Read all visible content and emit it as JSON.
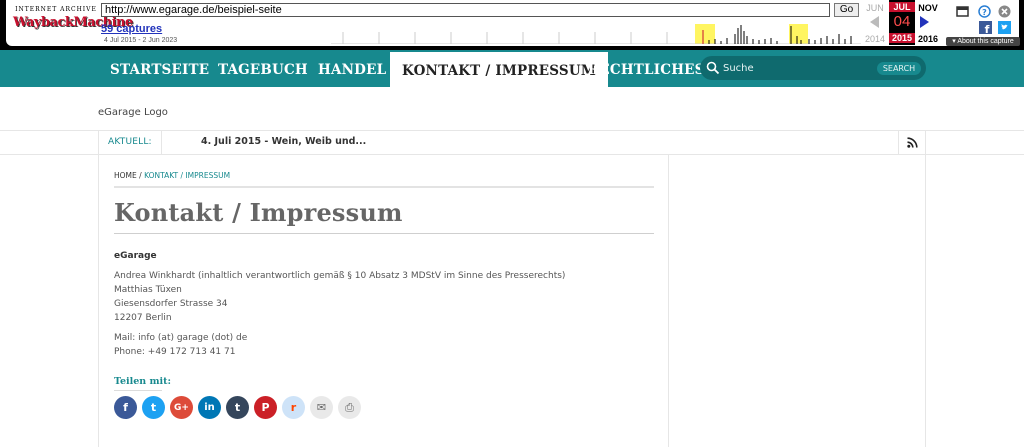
{
  "wayback": {
    "logo_top": "INTERNET ARCHIVE",
    "logo_main": "WaybackMachine",
    "url": "http://www.egarage.de/beispiel-seite",
    "go_label": "Go",
    "captures": "59 captures",
    "range": "4 Jul 2015 - 2 Jun 2023",
    "prev_month": "JUN",
    "cur_month": "JUL",
    "next_month": "NOV",
    "cur_day": "04",
    "prev_year": "2014",
    "cur_year": "2015",
    "next_year": "2016",
    "about": "▾ About this capture",
    "colors": {
      "accent": "#c8102e",
      "link": "#2233bb"
    }
  },
  "nav": {
    "items": [
      {
        "label": "STARTSEITE"
      },
      {
        "label": "TAGEBUCH"
      },
      {
        "label": "HANDEL"
      },
      {
        "label": "KONTAKT / IMPRESSUM"
      },
      {
        "label": "RECHTLICHES"
      }
    ],
    "active_index": 3,
    "search_placeholder": "Suche",
    "search_button": "SEARCH",
    "color": "#17898e"
  },
  "header": {
    "logo_alt": "eGarage Logo",
    "ticker_label": "AKTUELL:",
    "ticker_text": "4. Juli 2015 - Wein, Weib und..."
  },
  "content": {
    "breadcrumb_home": "HOME",
    "breadcrumb_sep": " / ",
    "breadcrumb_current": "KONTAKT / IMPRESSUM",
    "title": "Kontakt / Impressum",
    "company": "eGarage",
    "lines": [
      "Andrea Winkhardt (inhaltlich verantwortlich gemäß § 10 Absatz 3 MDStV im Sinne des Presserechts)",
      "Matthias Tüxen",
      "Giesensdorfer Strasse 34",
      "12207 Berlin"
    ],
    "mail": "Mail: info (at) garage (dot) de",
    "phone": "Phone: +49 172 713 41 71",
    "share_label": "Teilen mit:",
    "share_buttons": [
      {
        "icon": "facebook-icon",
        "glyph": "f",
        "color": "#3b5998"
      },
      {
        "icon": "twitter-icon",
        "glyph": "t",
        "color": "#1da1f2"
      },
      {
        "icon": "google-plus-icon",
        "glyph": "G+",
        "color": "#dd4b39"
      },
      {
        "icon": "linkedin-icon",
        "glyph": "in",
        "color": "#0077b5"
      },
      {
        "icon": "tumblr-icon",
        "glyph": "t",
        "color": "#35465c"
      },
      {
        "icon": "pinterest-icon",
        "glyph": "P",
        "color": "#cb2027"
      },
      {
        "icon": "reddit-icon",
        "glyph": "r",
        "color": "#cee3f8"
      },
      {
        "icon": "email-icon",
        "glyph": "✉",
        "color": "#e9e9e9"
      },
      {
        "icon": "print-icon",
        "glyph": "⎙",
        "color": "#e9e9e9"
      }
    ]
  }
}
